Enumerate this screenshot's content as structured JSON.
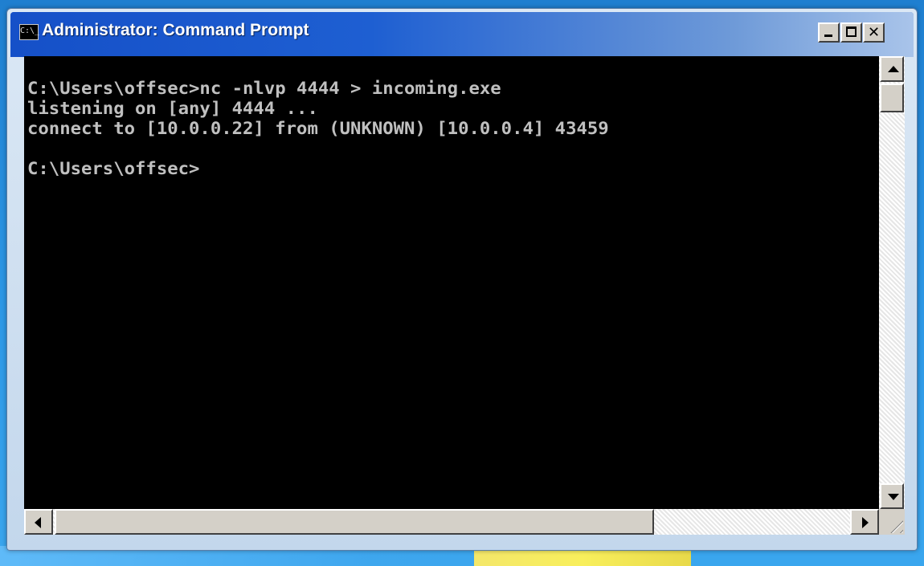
{
  "window": {
    "title": "Administrator: Command Prompt",
    "icon_label": "C:\\_",
    "icon_name": "cmd-console-icon",
    "controls": {
      "minimize": "minimize-icon",
      "maximize": "maximize-icon",
      "close": "close-icon",
      "close_glyph": "✕"
    }
  },
  "console": {
    "lines": [
      "C:\\Users\\offsec>nc -nlvp 4444 > incoming.exe",
      "listening on [any] 4444 ...",
      "connect to [10.0.0.22] from (UNKNOWN) [10.0.0.4] 43459",
      "",
      "C:\\Users\\offsec>"
    ]
  },
  "colors": {
    "console_bg": "#000000",
    "console_fg": "#c0c0c0",
    "titlebar_accent": "#1550c8"
  }
}
